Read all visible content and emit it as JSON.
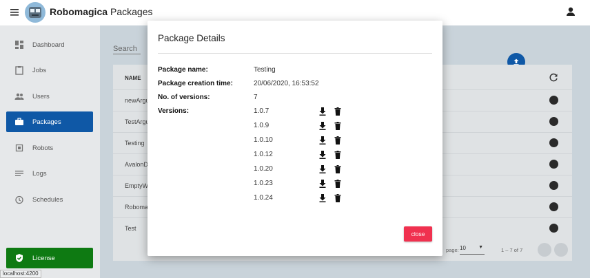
{
  "app": {
    "title": "Robomagica",
    "page_title": "Packages"
  },
  "sidebar": {
    "items": [
      {
        "label": "Dashboard",
        "icon": "dashboard-icon"
      },
      {
        "label": "Jobs",
        "icon": "clipboard-icon"
      },
      {
        "label": "Users",
        "icon": "users-icon"
      },
      {
        "label": "Packages",
        "icon": "briefcase-icon",
        "active": true
      },
      {
        "label": "Robots",
        "icon": "robot-icon"
      },
      {
        "label": "Logs",
        "icon": "list-icon"
      },
      {
        "label": "Schedules",
        "icon": "alarm-icon"
      }
    ],
    "license_label": "License"
  },
  "main": {
    "search_label": "Search",
    "table": {
      "header_name": "NAME",
      "rows": [
        "newArgu",
        "TestArgu",
        "Testing",
        "AvalonD",
        "EmptyW",
        "Roboma",
        "Test"
      ]
    },
    "pager": {
      "per_page_label": "page:",
      "per_page_value": "10",
      "range": "1 – 7 of 7"
    }
  },
  "dialog": {
    "title": "Package Details",
    "fields": {
      "name_label": "Package name:",
      "name_value": "Testing",
      "created_label": "Package creation time:",
      "created_value": "20/06/2020, 16:53:52",
      "count_label": "No. of versions:",
      "count_value": "7",
      "versions_label": "Versions:"
    },
    "versions": [
      "1.0.7",
      "1.0.9",
      "1.0.10",
      "1.0.12",
      "1.0.20",
      "1.0.23",
      "1.0.24"
    ],
    "close_label": "close"
  },
  "status_url": "localhost:4200",
  "colors": {
    "primary": "#0f58a6",
    "license": "#0e7a12",
    "close": "#f0314f"
  }
}
